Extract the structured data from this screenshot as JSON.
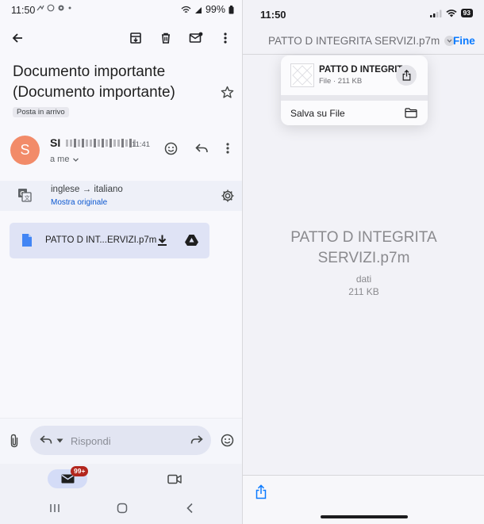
{
  "left": {
    "status": {
      "time": "11:50",
      "battery": "99%"
    },
    "subject": "Documento importante (Documento importante)",
    "label": "Posta in arrivo",
    "sender": {
      "avatar_letter": "S",
      "name_prefix": "SI",
      "time": "11:41",
      "to": "a me"
    },
    "translation": {
      "text": "inglese → italiano",
      "link": "Mostra originale"
    },
    "attachment": {
      "name": "PATTO D INT...ERVIZI.p7m"
    },
    "reply": {
      "placeholder": "Rispondi"
    },
    "nav": {
      "badge": "99+"
    },
    "icons": [
      "back-arrow-icon",
      "archive-icon",
      "trash-icon",
      "mark-unread-icon",
      "more-vert-icon",
      "star-icon",
      "emoji-icon",
      "reply-icon",
      "translate-icon",
      "settings-gear-icon",
      "file-icon",
      "download-icon",
      "drive-icon",
      "attach-icon",
      "forward-icon",
      "mail-icon",
      "video-icon"
    ]
  },
  "right": {
    "status": {
      "time": "11:50",
      "battery": "93"
    },
    "title": "PATTO D INTEGRITA SERVIZI.p7m",
    "done": "Fine",
    "popover": {
      "file_name": "PATTO D INTEGRITA...",
      "file_meta": "File · 211 KB",
      "save_label": "Salva su File"
    },
    "document": {
      "name": "PATTO D INTEGRITA SERVIZI.p7m",
      "kind": "dati",
      "size": "211 KB"
    },
    "icons": [
      "share-icon",
      "folder-icon",
      "chevron-down-icon"
    ]
  },
  "colors": {
    "avatar": "#f28b69",
    "link": "#0b57d0",
    "ios_accent": "#0a7aff",
    "badge": "#b3261e"
  }
}
